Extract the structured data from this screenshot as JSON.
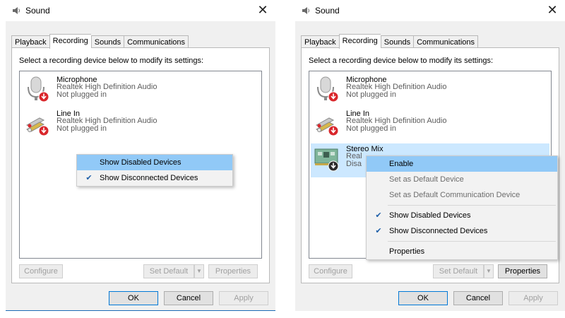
{
  "windows": [
    {
      "title": "Sound",
      "close": "✕",
      "tabs": [
        "Playback",
        "Recording",
        "Sounds",
        "Communications"
      ],
      "active_tab": "Recording",
      "instruction": "Select a recording device below to modify its settings:",
      "devices": [
        {
          "name": "Microphone",
          "driver": "Realtek High Definition Audio",
          "status": "Not plugged in",
          "icon": "microphone-icon"
        },
        {
          "name": "Line In",
          "driver": "Realtek High Definition Audio",
          "status": "Not plugged in",
          "icon": "line-in-icon"
        }
      ],
      "context_menu": [
        {
          "label": "Show Disabled Devices",
          "checked": false,
          "highlighted": true
        },
        {
          "label": "Show Disconnected Devices",
          "checked": true,
          "highlighted": false
        }
      ],
      "buttons": {
        "configure": "Configure",
        "set_default": "Set Default",
        "properties": "Properties",
        "ok": "OK",
        "cancel": "Cancel",
        "apply": "Apply"
      }
    },
    {
      "title": "Sound",
      "close": "✕",
      "tabs": [
        "Playback",
        "Recording",
        "Sounds",
        "Communications"
      ],
      "active_tab": "Recording",
      "instruction": "Select a recording device below to modify its settings:",
      "devices": [
        {
          "name": "Microphone",
          "driver": "Realtek High Definition Audio",
          "status": "Not plugged in",
          "icon": "microphone-icon"
        },
        {
          "name": "Line In",
          "driver": "Realtek High Definition Audio",
          "status": "Not plugged in",
          "icon": "line-in-icon"
        },
        {
          "name": "Stereo Mix",
          "driver": "Real",
          "status": "Disa",
          "icon": "stereo-mix-icon",
          "selected": true
        }
      ],
      "context_menu": [
        {
          "label": "Enable",
          "highlighted": true
        },
        {
          "label": "Set as Default Device",
          "disabled": true
        },
        {
          "label": "Set as Default Communication Device",
          "disabled": true
        },
        {
          "separator": true
        },
        {
          "label": "Show Disabled Devices",
          "checked": true
        },
        {
          "label": "Show Disconnected Devices",
          "checked": true
        },
        {
          "separator": true
        },
        {
          "label": "Properties"
        }
      ],
      "buttons": {
        "configure": "Configure",
        "set_default": "Set Default",
        "properties": "Properties",
        "ok": "OK",
        "cancel": "Cancel",
        "apply": "Apply"
      }
    }
  ],
  "colors": {
    "menu_highlight": "#91c9f7",
    "selected_row": "#cce8ff",
    "accent": "#0078d7",
    "error_red": "#d9262b"
  },
  "check_glyph": "✔",
  "split_arrow": "▼"
}
